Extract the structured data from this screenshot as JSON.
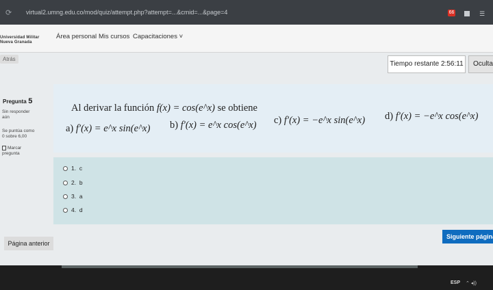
{
  "browser": {
    "url": "virtual2.umng.edu.co/mod/quiz/attempt.php?attempt=...&cmid=...&page=4",
    "badge_count": "66"
  },
  "navbar": {
    "logo_line1": "Universidad Militar",
    "logo_line2": "Nueva Granada",
    "links": [
      "Área personal",
      "Mis cursos",
      "Capacitaciones ˅"
    ]
  },
  "page": {
    "back_label": "Atrás",
    "timer_label": "Tiempo restante 2:56:11",
    "hide_label": "Ocultar"
  },
  "question": {
    "label": "Pregunta",
    "number": "5",
    "status": [
      "Sin responder",
      "aún"
    ],
    "score": [
      "Se puntúa como",
      "0 sobre 6,00"
    ],
    "flag_label": [
      "Marcar",
      "pregunta"
    ],
    "text_prefix": "Al derivar la función ",
    "text_math": "f(x) = cos(e^x)",
    "text_suffix": " se obtiene",
    "options": [
      {
        "letter": "a)",
        "math": "f′(x) = e^x sin(e^x)"
      },
      {
        "letter": "b)",
        "math": "f′(x) = e^x cos(e^x)"
      },
      {
        "letter": "c)",
        "math": "f′(x) = −e^x sin(e^x)"
      },
      {
        "letter": "d)",
        "math": "f′(x) = −e^x cos(e^x)"
      }
    ],
    "answers": [
      {
        "num": "1.",
        "label": "c"
      },
      {
        "num": "2.",
        "label": "b"
      },
      {
        "num": "3.",
        "label": "a"
      },
      {
        "num": "4.",
        "label": "d"
      }
    ]
  },
  "footer": {
    "prev_label": "Página anterior",
    "next_label": "Siguiente página"
  },
  "taskbar": {
    "lang": "ESP"
  }
}
